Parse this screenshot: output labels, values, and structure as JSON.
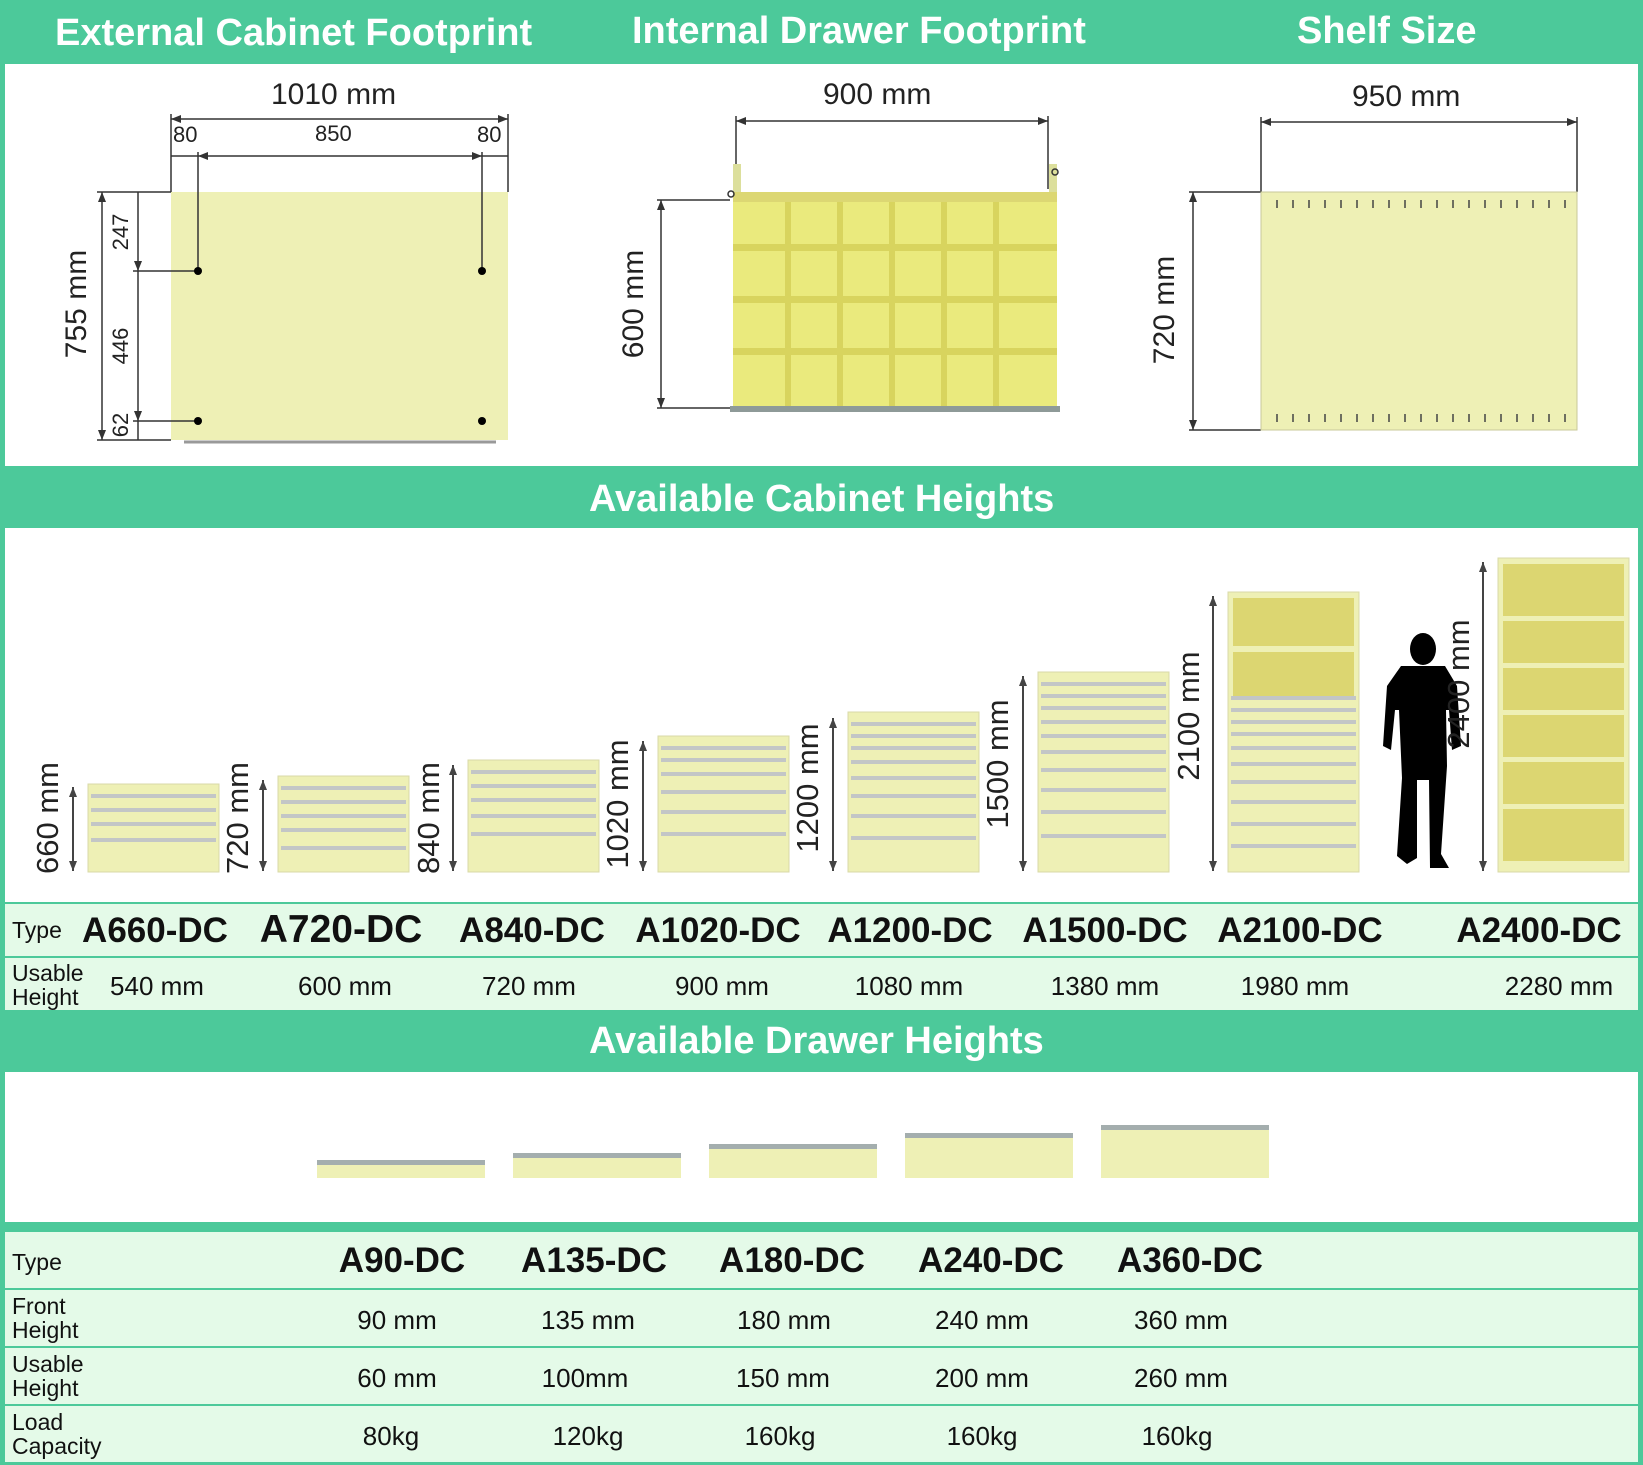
{
  "sections": {
    "external_title": "External Cabinet Footprint",
    "internal_title": "Internal Drawer Footprint",
    "shelf_title": "Shelf Size",
    "cabinet_heights_title": "Available Cabinet Heights",
    "drawer_heights_title": "Available Drawer Heights"
  },
  "colors": {
    "band": "#4cc99a",
    "panel": "#ffffff",
    "cabinet": "#eef0b5",
    "row": "#e4fae8",
    "dark": "#222222"
  },
  "external": {
    "width": "1010 mm",
    "left_offset": "80",
    "span": "850",
    "right_offset": "80",
    "depth": "755 mm",
    "front": "247",
    "mid": "446",
    "back": "62"
  },
  "internal": {
    "width": "900 mm",
    "depth": "600 mm"
  },
  "shelf": {
    "width": "950 mm",
    "depth": "720 mm"
  },
  "cabinets": {
    "type_label": "Type",
    "usable_label": "Usable Height",
    "items": [
      {
        "height": "660 mm",
        "type": "A660-DC",
        "usable": "540 mm"
      },
      {
        "height": "720 mm",
        "type": "A720-DC",
        "usable": "600 mm"
      },
      {
        "height": "840 mm",
        "type": "A840-DC",
        "usable": "720 mm"
      },
      {
        "height": "1020 mm",
        "type": "A1020-DC",
        "usable": "900 mm"
      },
      {
        "height": "1200 mm",
        "type": "A1200-DC",
        "usable": "1080 mm"
      },
      {
        "height": "1500 mm",
        "type": "A1500-DC",
        "usable": "1380 mm"
      },
      {
        "height": "2100 mm",
        "type": "A2100-DC",
        "usable": "1980 mm"
      },
      {
        "height": "2400 mm",
        "type": "A2400-DC",
        "usable": "2280 mm"
      }
    ]
  },
  "drawers": {
    "type_label": "Type",
    "front_label": "Front Height",
    "usable_label": "Usable Height",
    "load_label": "Load Capacity",
    "items": [
      {
        "type": "A90-DC",
        "front": "90 mm",
        "usable": "60 mm",
        "load": "80kg"
      },
      {
        "type": "A135-DC",
        "front": "135 mm",
        "usable": "100mm",
        "load": "120kg"
      },
      {
        "type": "A180-DC",
        "front": "180 mm",
        "usable": "150 mm",
        "load": "160kg"
      },
      {
        "type": "A240-DC",
        "front": "240 mm",
        "usable": "200 mm",
        "load": "160kg"
      },
      {
        "type": "A360-DC",
        "front": "360 mm",
        "usable": "260 mm",
        "load": "160kg"
      }
    ]
  }
}
